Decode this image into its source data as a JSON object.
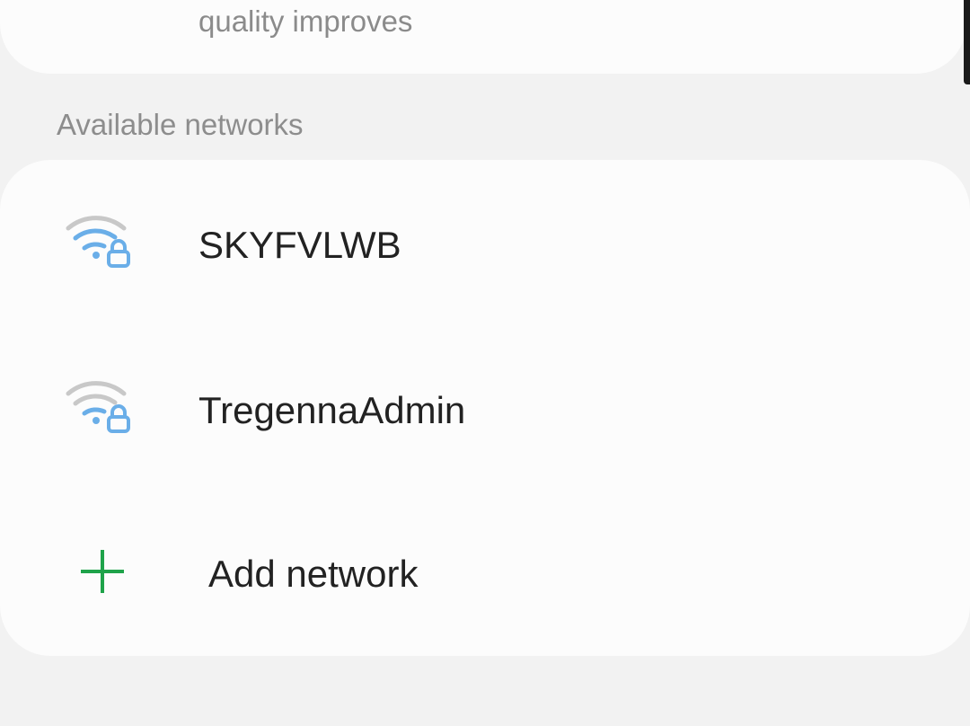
{
  "top_card": {
    "subtitle_fragment": "quality improves"
  },
  "available_networks": {
    "header": "Available networks",
    "networks": [
      {
        "ssid": "SKYFVLWB",
        "icon": "wifi-lock-icon",
        "secured": true,
        "signal_bars": 2
      },
      {
        "ssid": "TregennaAdmin",
        "icon": "wifi-lock-icon",
        "secured": true,
        "signal_bars": 2
      }
    ],
    "add_network": {
      "label": "Add network",
      "icon": "plus-icon"
    }
  },
  "colors": {
    "background": "#f2f2f2",
    "card": "#fcfcfc",
    "wifi_active": "#6aaee8",
    "wifi_inactive": "#c8c8c8",
    "add_green": "#1fa34a",
    "primary_text": "#222222",
    "secondary_text": "#8b8b8b"
  }
}
